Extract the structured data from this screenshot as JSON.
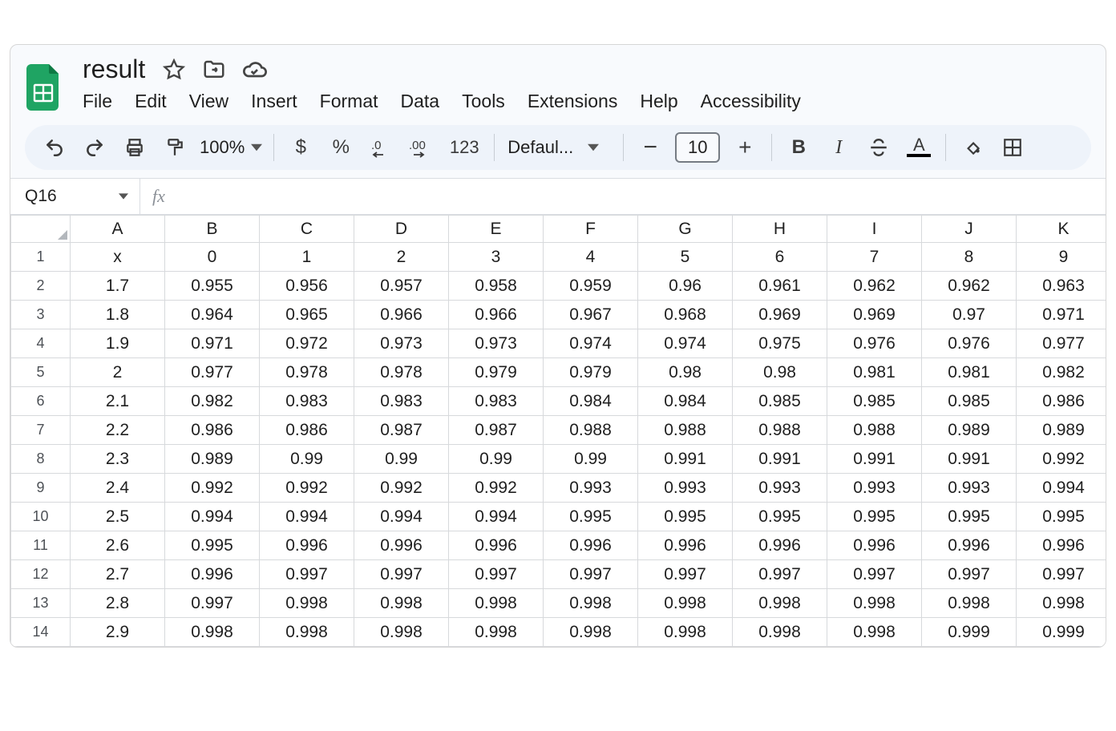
{
  "doc": {
    "title": "result"
  },
  "menus": {
    "file": "File",
    "edit": "Edit",
    "view": "View",
    "insert": "Insert",
    "format": "Format",
    "data": "Data",
    "tools": "Tools",
    "extensions": "Extensions",
    "help": "Help",
    "accessibility": "Accessibility"
  },
  "toolbar": {
    "zoom": "100%",
    "currency": "$",
    "percent": "%",
    "num_123": "123",
    "font": "Defaul...",
    "font_size": "10"
  },
  "namebox": {
    "ref": "Q16"
  },
  "formula_bar": {
    "value": ""
  },
  "columns": [
    "A",
    "B",
    "C",
    "D",
    "E",
    "F",
    "G",
    "H",
    "I",
    "J",
    "K"
  ],
  "row_numbers": [
    "1",
    "2",
    "3",
    "4",
    "5",
    "6",
    "7",
    "8",
    "9",
    "10",
    "11",
    "12",
    "13",
    "14"
  ],
  "cells": [
    [
      "x",
      "0",
      "1",
      "2",
      "3",
      "4",
      "5",
      "6",
      "7",
      "8",
      "9"
    ],
    [
      "1.7",
      "0.955",
      "0.956",
      "0.957",
      "0.958",
      "0.959",
      "0.96",
      "0.961",
      "0.962",
      "0.962",
      "0.963"
    ],
    [
      "1.8",
      "0.964",
      "0.965",
      "0.966",
      "0.966",
      "0.967",
      "0.968",
      "0.969",
      "0.969",
      "0.97",
      "0.971"
    ],
    [
      "1.9",
      "0.971",
      "0.972",
      "0.973",
      "0.973",
      "0.974",
      "0.974",
      "0.975",
      "0.976",
      "0.976",
      "0.977"
    ],
    [
      "2",
      "0.977",
      "0.978",
      "0.978",
      "0.979",
      "0.979",
      "0.98",
      "0.98",
      "0.981",
      "0.981",
      "0.982"
    ],
    [
      "2.1",
      "0.982",
      "0.983",
      "0.983",
      "0.983",
      "0.984",
      "0.984",
      "0.985",
      "0.985",
      "0.985",
      "0.986"
    ],
    [
      "2.2",
      "0.986",
      "0.986",
      "0.987",
      "0.987",
      "0.988",
      "0.988",
      "0.988",
      "0.988",
      "0.989",
      "0.989"
    ],
    [
      "2.3",
      "0.989",
      "0.99",
      "0.99",
      "0.99",
      "0.99",
      "0.991",
      "0.991",
      "0.991",
      "0.991",
      "0.992"
    ],
    [
      "2.4",
      "0.992",
      "0.992",
      "0.992",
      "0.992",
      "0.993",
      "0.993",
      "0.993",
      "0.993",
      "0.993",
      "0.994"
    ],
    [
      "2.5",
      "0.994",
      "0.994",
      "0.994",
      "0.994",
      "0.995",
      "0.995",
      "0.995",
      "0.995",
      "0.995",
      "0.995"
    ],
    [
      "2.6",
      "0.995",
      "0.996",
      "0.996",
      "0.996",
      "0.996",
      "0.996",
      "0.996",
      "0.996",
      "0.996",
      "0.996"
    ],
    [
      "2.7",
      "0.996",
      "0.997",
      "0.997",
      "0.997",
      "0.997",
      "0.997",
      "0.997",
      "0.997",
      "0.997",
      "0.997"
    ],
    [
      "2.8",
      "0.997",
      "0.998",
      "0.998",
      "0.998",
      "0.998",
      "0.998",
      "0.998",
      "0.998",
      "0.998",
      "0.998"
    ],
    [
      "2.9",
      "0.998",
      "0.998",
      "0.998",
      "0.998",
      "0.998",
      "0.998",
      "0.998",
      "0.998",
      "0.999",
      "0.999"
    ]
  ]
}
